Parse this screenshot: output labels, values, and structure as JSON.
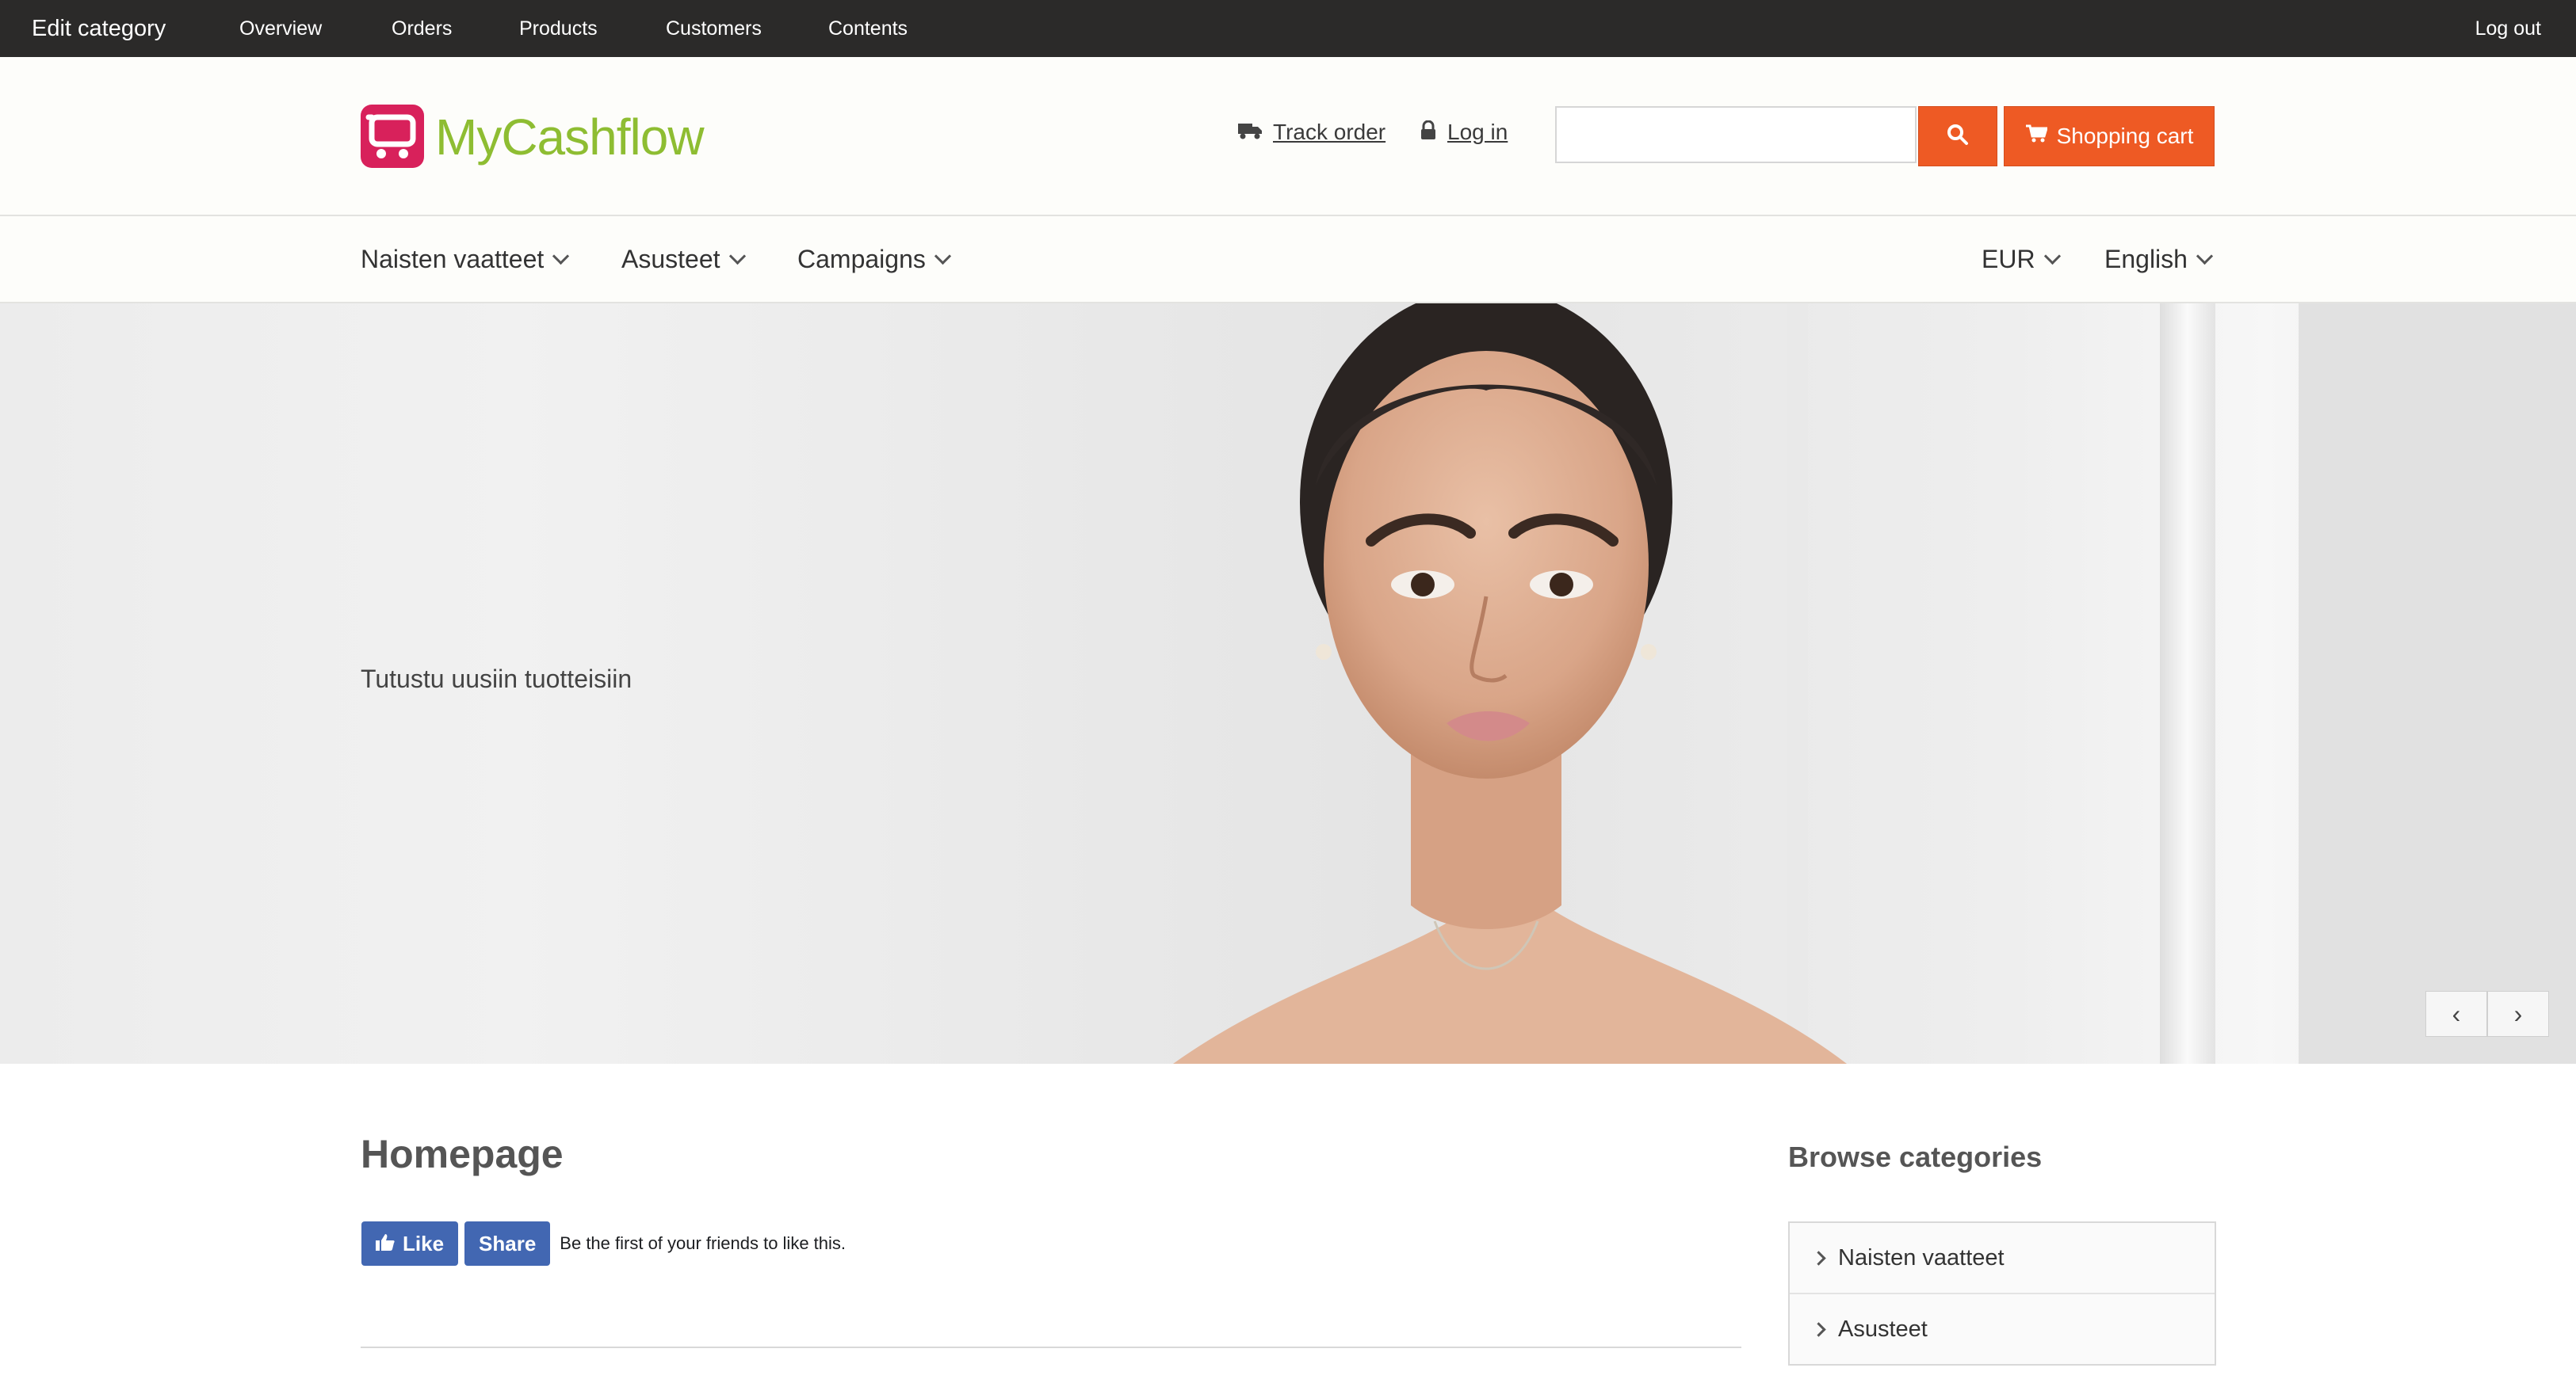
{
  "admin_bar": {
    "title": "Edit category",
    "nav": [
      "Overview",
      "Orders",
      "Products",
      "Customers",
      "Contents"
    ],
    "logout": "Log out"
  },
  "header": {
    "logo_text": "MyCashflow",
    "track_order": "Track order",
    "log_in": "Log in",
    "search_placeholder": "",
    "cart_label": "Shopping cart"
  },
  "categories_bar": {
    "items": [
      "Naisten vaatteet",
      "Asusteet",
      "Campaigns"
    ],
    "currency": "EUR",
    "language": "English"
  },
  "hero": {
    "caption": "Tutustu uusiin tuotteisiin",
    "prev": "‹",
    "next": "›"
  },
  "main": {
    "title": "Homepage",
    "fb_like": "Like",
    "fb_share": "Share",
    "fb_text": "Be the first of your friends to like this."
  },
  "sidebar": {
    "title": "Browse categories",
    "items": [
      "Naisten vaatteet",
      "Asusteet"
    ]
  },
  "colors": {
    "admin_bar": "#2b2a29",
    "accent": "#ee5a24",
    "logo_icon": "#d8215b",
    "logo_text": "#8ebd32",
    "facebook": "#4267b2"
  }
}
